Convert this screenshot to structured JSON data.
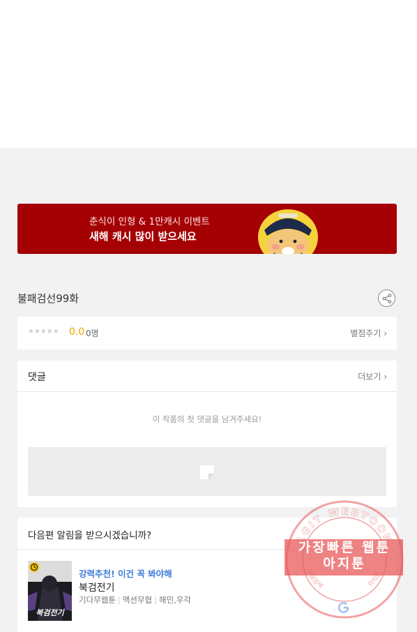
{
  "banner": {
    "line1": "춘식이 인형 & 1만캐시 이벤트",
    "line2": "새해 캐시 많이 받으세요",
    "bg_color": "#a50003"
  },
  "episode": {
    "title": "불패검선99화",
    "share_icon": "share-icon"
  },
  "rating": {
    "stars": "★★★★★",
    "score": "0.0",
    "count": "0명",
    "rate_button": "별점주기 ›",
    "score_color": "#f2a200"
  },
  "comments": {
    "title": "댓글",
    "more_button": "더보기 ›",
    "empty_text": "이 작품의 첫 댓글을 남겨주세요!"
  },
  "notify": {
    "title": "다음편 알림을 받으시겠습니까?",
    "recommendation": {
      "label": "강력추천! 이건 꼭 봐야해",
      "title": "북검전기",
      "meta": [
        "기다무웹툰",
        "액션무협",
        "해민,우각"
      ],
      "thumbnail_text": "북검전기",
      "badge_icon": "clock-icon",
      "label_color": "#3d7bd9"
    }
  },
  "watermark": {
    "ring_top": "AGIT WEBTOON",
    "line1": "가장빠른 웹툰",
    "line2": "아지툰",
    "ring_bottom_left": "구글검색",
    "ring_bottom_right": "아지툰",
    "logo_icon": "google-g-icon",
    "color": "#e85a5a"
  }
}
